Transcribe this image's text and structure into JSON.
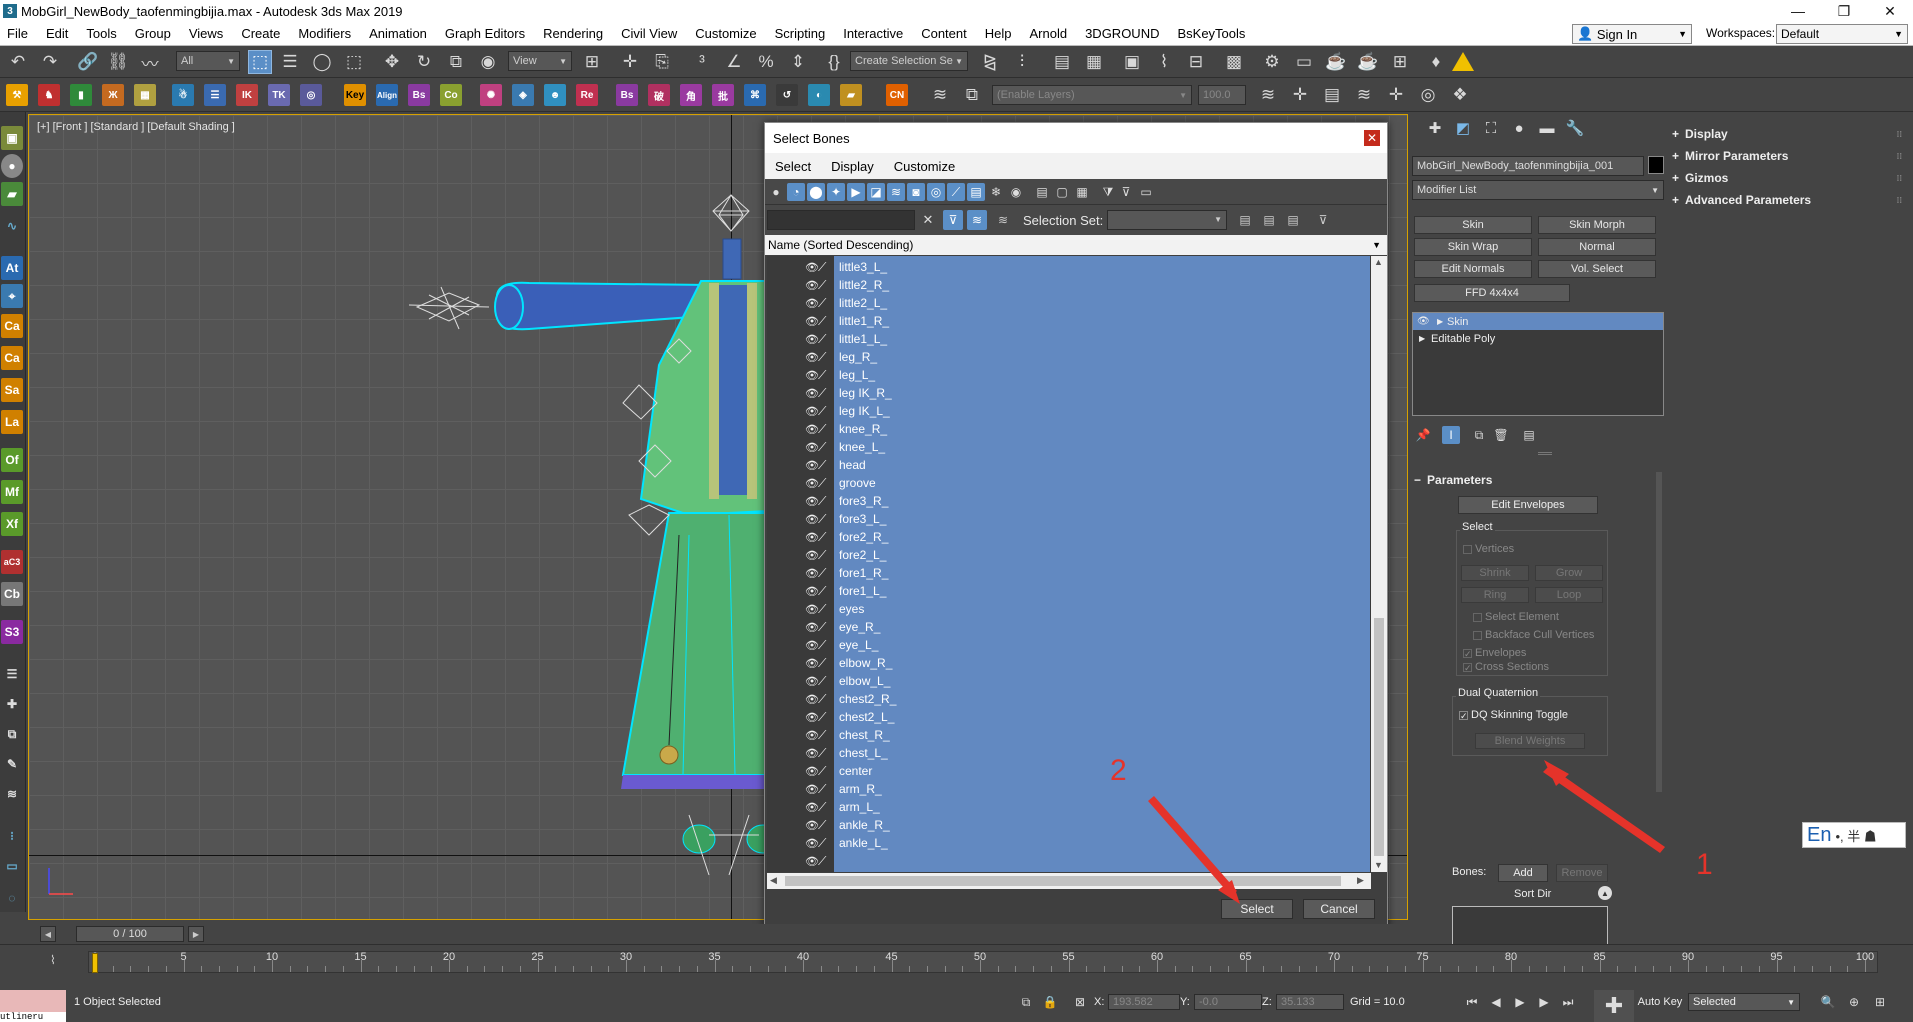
{
  "window": {
    "title": "MobGirl_NewBody_taofenmingbijia.max - Autodesk 3ds Max 2019"
  },
  "menubar": {
    "items": [
      "File",
      "Edit",
      "Tools",
      "Group",
      "Views",
      "Create",
      "Modifiers",
      "Animation",
      "Graph Editors",
      "Rendering",
      "Civil View",
      "Customize",
      "Scripting",
      "Interactive",
      "Content",
      "Help",
      "Arnold",
      "3DGROUND",
      "BsKeyTools"
    ],
    "sign_in": "Sign In",
    "workspaces_label": "Workspaces:",
    "workspaces_value": "Default"
  },
  "toolbar": {
    "selection_filter": "All",
    "ref_coord": "View",
    "named_selection": "Create Selection Se",
    "layer_placeholder": "(Enable Layers)",
    "layer_value": "100.0",
    "plugin_buttons": [
      "Key",
      "Align",
      "Bs",
      "Co",
      "Re",
      "Bs",
      "破",
      "角",
      "批",
      "CN"
    ]
  },
  "left_strip": {
    "buttons": [
      "At",
      "Ca",
      "Ca",
      "Sa",
      "La",
      "Of",
      "Mf",
      "Xf",
      "aC3",
      "Cb",
      "S3"
    ]
  },
  "viewport": {
    "label": "[+] [Front ] [Standard ] [Default Shading ]"
  },
  "dialog": {
    "title": "Select Bones",
    "menu": [
      "Select",
      "Display",
      "Customize"
    ],
    "selection_set_label": "Selection Set:",
    "column_header": "Name (Sorted Descending)",
    "bones": [
      "little3_L_",
      "little2_R_",
      "little2_L_",
      "little1_R_",
      "little1_L_",
      "leg_R_",
      "leg_L_",
      "leg IK_R_",
      "leg IK_L_",
      "knee_R_",
      "knee_L_",
      "head",
      "groove",
      "fore3_R_",
      "fore3_L_",
      "fore2_R_",
      "fore2_L_",
      "fore1_R_",
      "fore1_L_",
      "eyes",
      "eye_R_",
      "eye_L_",
      "elbow_R_",
      "elbow_L_",
      "chest2_R_",
      "chest2_L_",
      "chest_R_",
      "chest_L_",
      "center",
      "arm_R_",
      "arm_L_",
      "ankle_R_",
      "ankle_L_",
      ""
    ],
    "select_button": "Select",
    "cancel_button": "Cancel"
  },
  "command_panel": {
    "object_name": "MobGirl_NewBody_taofenmingbijia_001",
    "modifier_list": "Modifier List",
    "modifier_buttons": [
      "Skin",
      "Skin Morph",
      "Skin Wrap",
      "Normal",
      "Edit Normals",
      "Vol. Select",
      "FFD 4x4x4"
    ],
    "stack": [
      "Skin",
      "Editable Poly"
    ],
    "rollouts_right": [
      "Display",
      "Mirror Parameters",
      "Gizmos",
      "Advanced Parameters"
    ],
    "parameters": {
      "header": "Parameters",
      "edit_envelopes": "Edit Envelopes",
      "select_group": "Select",
      "vertices": "Vertices",
      "shrink": "Shrink",
      "grow": "Grow",
      "ring": "Ring",
      "loop": "Loop",
      "select_element": "Select Element",
      "backface_cull": "Backface Cull Vertices",
      "envelopes": "Envelopes",
      "cross_sections": "Cross Sections",
      "dq_group": "Dual Quaternion",
      "dq_toggle": "DQ Skinning Toggle",
      "blend_weights": "Blend Weights",
      "bones_label": "Bones:",
      "add": "Add",
      "remove": "Remove",
      "sort_label": "Sort Dir"
    }
  },
  "timeline": {
    "frame_display": "0 / 100",
    "ticks": [
      0,
      5,
      10,
      15,
      20,
      25,
      30,
      35,
      40,
      45,
      50,
      55,
      60,
      65,
      70,
      75,
      80,
      85,
      90,
      95,
      100
    ]
  },
  "statusbar": {
    "mini_listener": "utlineru",
    "status": "1 Object Selected",
    "x_label": "X:",
    "x_value": "193.582",
    "y_label": "Y:",
    "y_value": "-0.0",
    "z_label": "Z:",
    "z_value": "35.133",
    "grid": "Grid = 10.0",
    "auto_key": "Auto Key",
    "key_filter": "Selected"
  },
  "annotations": {
    "step1": "1",
    "step2": "2"
  },
  "ime": {
    "lang": "En",
    "extra": "•, 半 ☗"
  },
  "colors": {
    "selection_blue": "#6289c1",
    "annotation_red": "#e5332a",
    "viewport_border": "#d6a100"
  }
}
